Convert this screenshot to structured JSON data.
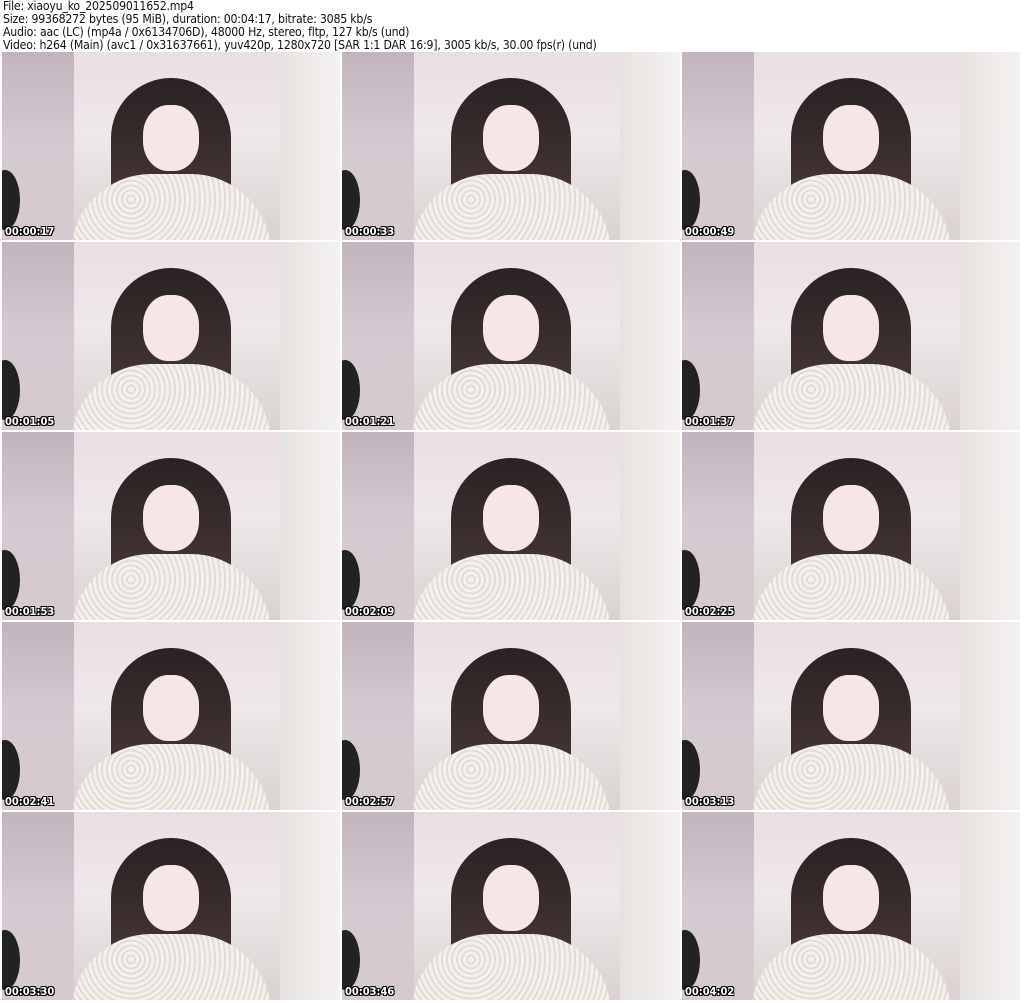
{
  "header": {
    "file": "File: xiaoyu_ko_202509011652.mp4",
    "size": "Size: 99368272 bytes (95 MiB), duration: 00:04:17, bitrate: 3085 kb/s",
    "audio": "Audio: aac (LC) (mp4a / 0x6134706D), 48000 Hz, stereo, fltp, 127 kb/s (und)",
    "video": "Video: h264 (Main) (avc1 / 0x31637661), yuv420p, 1280x720 [SAR 1:1 DAR 16:9], 3005 kb/s, 30.00 fps(r) (und)"
  },
  "thumbnails": [
    "00:00:17",
    "00:00:33",
    "00:00:49",
    "00:01:05",
    "00:01:21",
    "00:01:37",
    "00:01:53",
    "00:02:09",
    "00:02:25",
    "00:02:41",
    "00:02:57",
    "00:03:13",
    "00:03:30",
    "00:03:46",
    "00:04:02"
  ]
}
